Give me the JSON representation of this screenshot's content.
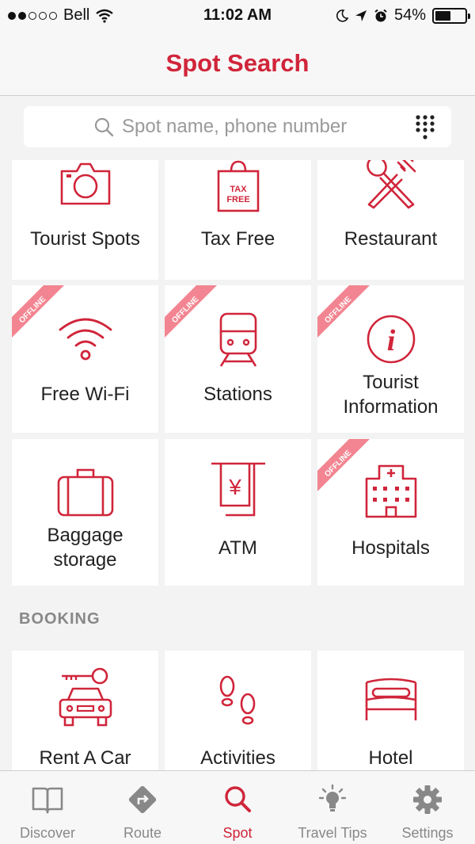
{
  "status_bar": {
    "carrier": "Bell",
    "time": "11:02 AM",
    "battery": "54%",
    "battery_level": 0.54,
    "signal_bars": 2,
    "signal_total": 5
  },
  "header": {
    "title": "Spot Search"
  },
  "search": {
    "placeholder": "Spot name, phone number"
  },
  "tiles": [
    {
      "label": "Tourist Spots",
      "icon": "camera-icon",
      "offline": false
    },
    {
      "label": "Tax Free",
      "icon": "tax-free-bag-icon",
      "icon_text_1": "TAX",
      "icon_text_2": "FREE",
      "offline": false
    },
    {
      "label": "Restaurant",
      "icon": "fork-spoon-icon",
      "offline": false
    },
    {
      "label": "Free Wi-Fi",
      "icon": "wifi-icon",
      "offline": true
    },
    {
      "label": "Stations",
      "icon": "train-icon",
      "offline": true
    },
    {
      "label_line1": "Tourist",
      "label_line2": "Information",
      "icon": "info-icon",
      "icon_text": "i",
      "offline": true
    },
    {
      "label_line1": "Baggage",
      "label_line2": "storage",
      "icon": "luggage-icon",
      "offline": false
    },
    {
      "label": "ATM",
      "icon": "atm-icon",
      "icon_text": "¥",
      "offline": false
    },
    {
      "label": "Hospitals",
      "icon": "hospital-icon",
      "offline": true
    }
  ],
  "offline_badge": "OFFLINE",
  "booking": {
    "heading": "BOOKING",
    "tiles": [
      {
        "label": "Rent A Car",
        "icon": "car-key-icon"
      },
      {
        "label": "Activities",
        "icon": "footprints-icon"
      },
      {
        "label": "Hotel",
        "icon": "bed-icon"
      }
    ]
  },
  "tab_bar": [
    {
      "label": "Discover",
      "icon": "book-icon",
      "active": false
    },
    {
      "label": "Route",
      "icon": "route-sign-icon",
      "active": false
    },
    {
      "label": "Spot",
      "icon": "search-icon",
      "active": true
    },
    {
      "label": "Travel Tips",
      "icon": "lightbulb-icon",
      "active": false
    },
    {
      "label": "Settings",
      "icon": "gear-icon",
      "active": false
    }
  ],
  "colors": {
    "accent": "#d0253a",
    "background": "#f3f3f3",
    "tile": "#ffffff",
    "ribbon": "#f28591",
    "inactive": "#888888"
  }
}
